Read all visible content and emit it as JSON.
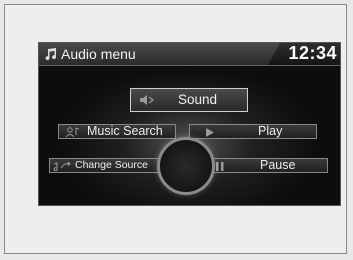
{
  "header": {
    "title": "Audio menu",
    "clock": "12:34"
  },
  "menu": {
    "sound_label": "Sound",
    "music_search_label": "Music Search",
    "play_label": "Play",
    "change_source_label": "Change Source",
    "pause_label": "Pause"
  },
  "icons": {
    "title": "music-note-icon",
    "sound": "speaker-icon",
    "music_search": "person-music-icon",
    "play": "play-icon",
    "change_source": "source-change-icon",
    "pause": "pause-icon"
  }
}
